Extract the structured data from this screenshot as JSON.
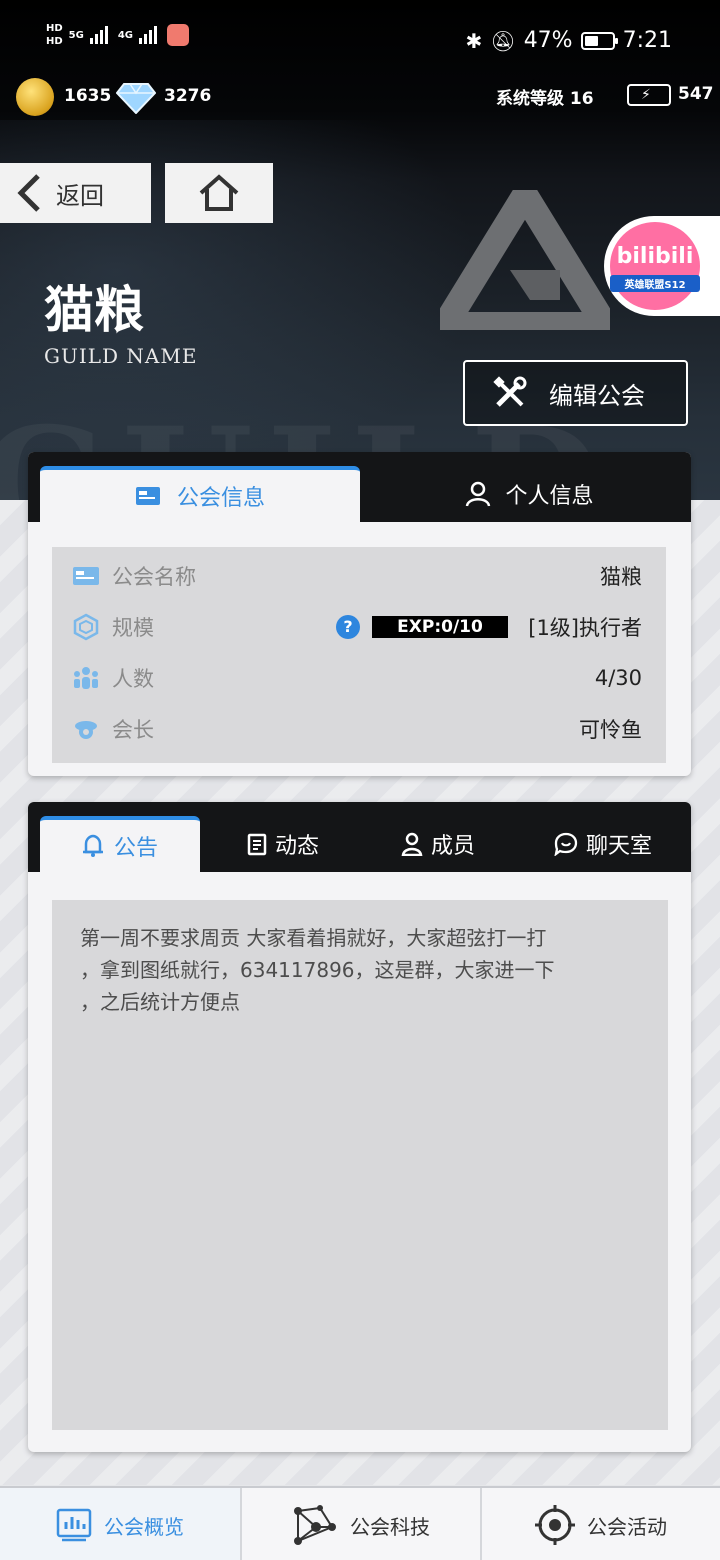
{
  "status_bar": {
    "hd1": "HD",
    "hd2": "HD",
    "net1": "5G",
    "net2": "4G",
    "battery_percent": "47%",
    "time": "7:21"
  },
  "currency": {
    "coins": "1635",
    "gems": "3276",
    "system_level": "系统等级 16",
    "energy": "547"
  },
  "nav": {
    "back_label": "返回"
  },
  "badge": {
    "brand": "bilibili",
    "sub": "英雄联盟S12"
  },
  "guild": {
    "name": "猫粮",
    "subtitle": "GUILD  NAME",
    "edit_label": "编辑公会"
  },
  "info_panel": {
    "tabs": [
      "公会信息",
      "个人信息"
    ],
    "rows": [
      {
        "label": "公会名称",
        "value": "猫粮"
      },
      {
        "label": "规模",
        "value": "[1级]执行者",
        "exp": "EXP:0/10",
        "help": "?"
      },
      {
        "label": "人数",
        "value": "4/30"
      },
      {
        "label": "会长",
        "value": "可怜鱼"
      }
    ]
  },
  "announcement_panel": {
    "tabs": [
      "公告",
      "动态",
      "成员",
      "聊天室"
    ],
    "lines": [
      "第一周不要求周贡 大家看着捐就好，大家超弦打一打",
      "，拿到图纸就行，634117896，这是群，大家进一下",
      "，之后统计方便点"
    ]
  },
  "bottom_nav": [
    "公会概览",
    "公会科技",
    "公会活动"
  ],
  "colors": {
    "accent": "#3a8fe0",
    "dark": "#141517",
    "panel": "#f4f4f6"
  }
}
